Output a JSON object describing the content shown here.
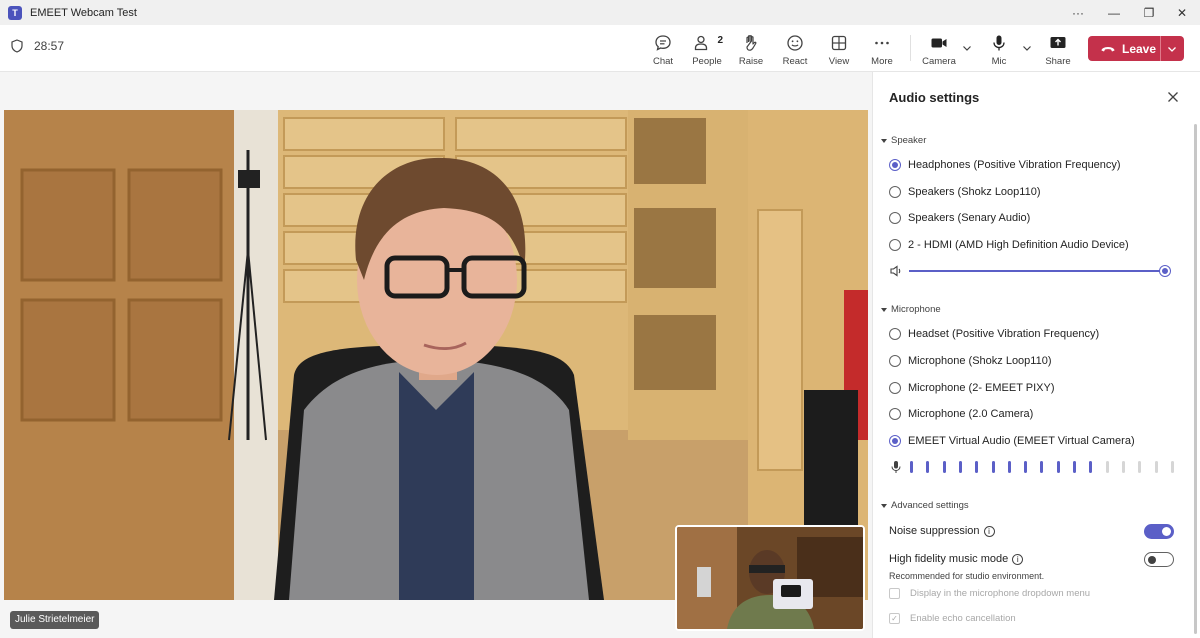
{
  "window": {
    "title": "EMEET Webcam Test",
    "more_label": "···",
    "minimize_label": "—",
    "restore_label": "❐",
    "close_label": "✕"
  },
  "meeting": {
    "timer": "28:57",
    "people_count": "2",
    "toolbar": {
      "chat": "Chat",
      "people": "People",
      "raise": "Raise",
      "react": "React",
      "view": "View",
      "more": "More",
      "camera": "Camera",
      "mic": "Mic",
      "share": "Share",
      "leave": "Leave"
    }
  },
  "stage": {
    "participant_name": "Julie Strietelmeier"
  },
  "audio_settings": {
    "title": "Audio settings",
    "speaker": {
      "heading": "Speaker",
      "options": [
        "Headphones (Positive Vibration Frequency)",
        "Speakers (Shokz Loop110)",
        "Speakers (Senary Audio)",
        "2 - HDMI (AMD High Definition Audio Device)"
      ],
      "selected_index": 0,
      "volume_percent": 100
    },
    "microphone": {
      "heading": "Microphone",
      "options": [
        "Headset (Positive Vibration Frequency)",
        "Microphone (Shokz Loop110)",
        "Microphone (2- EMEET PIXY)",
        "Microphone (2.0 Camera)",
        "EMEET Virtual Audio (EMEET Virtual Camera)"
      ],
      "selected_index": 4,
      "level_active_bars": 12,
      "level_total_bars": 17
    },
    "advanced": {
      "heading": "Advanced settings",
      "noise_suppression": {
        "label": "Noise suppression",
        "on": true
      },
      "hifi_music": {
        "label": "High fidelity music mode",
        "on": false,
        "note": "Recommended for studio environment."
      },
      "show_in_dropdown": {
        "label": "Display in the microphone dropdown menu",
        "checked": false
      },
      "echo_cancellation": {
        "label": "Enable echo cancellation",
        "checked": true
      }
    }
  },
  "colors": {
    "accent": "#5b5fc7",
    "leave": "#c4314b"
  }
}
